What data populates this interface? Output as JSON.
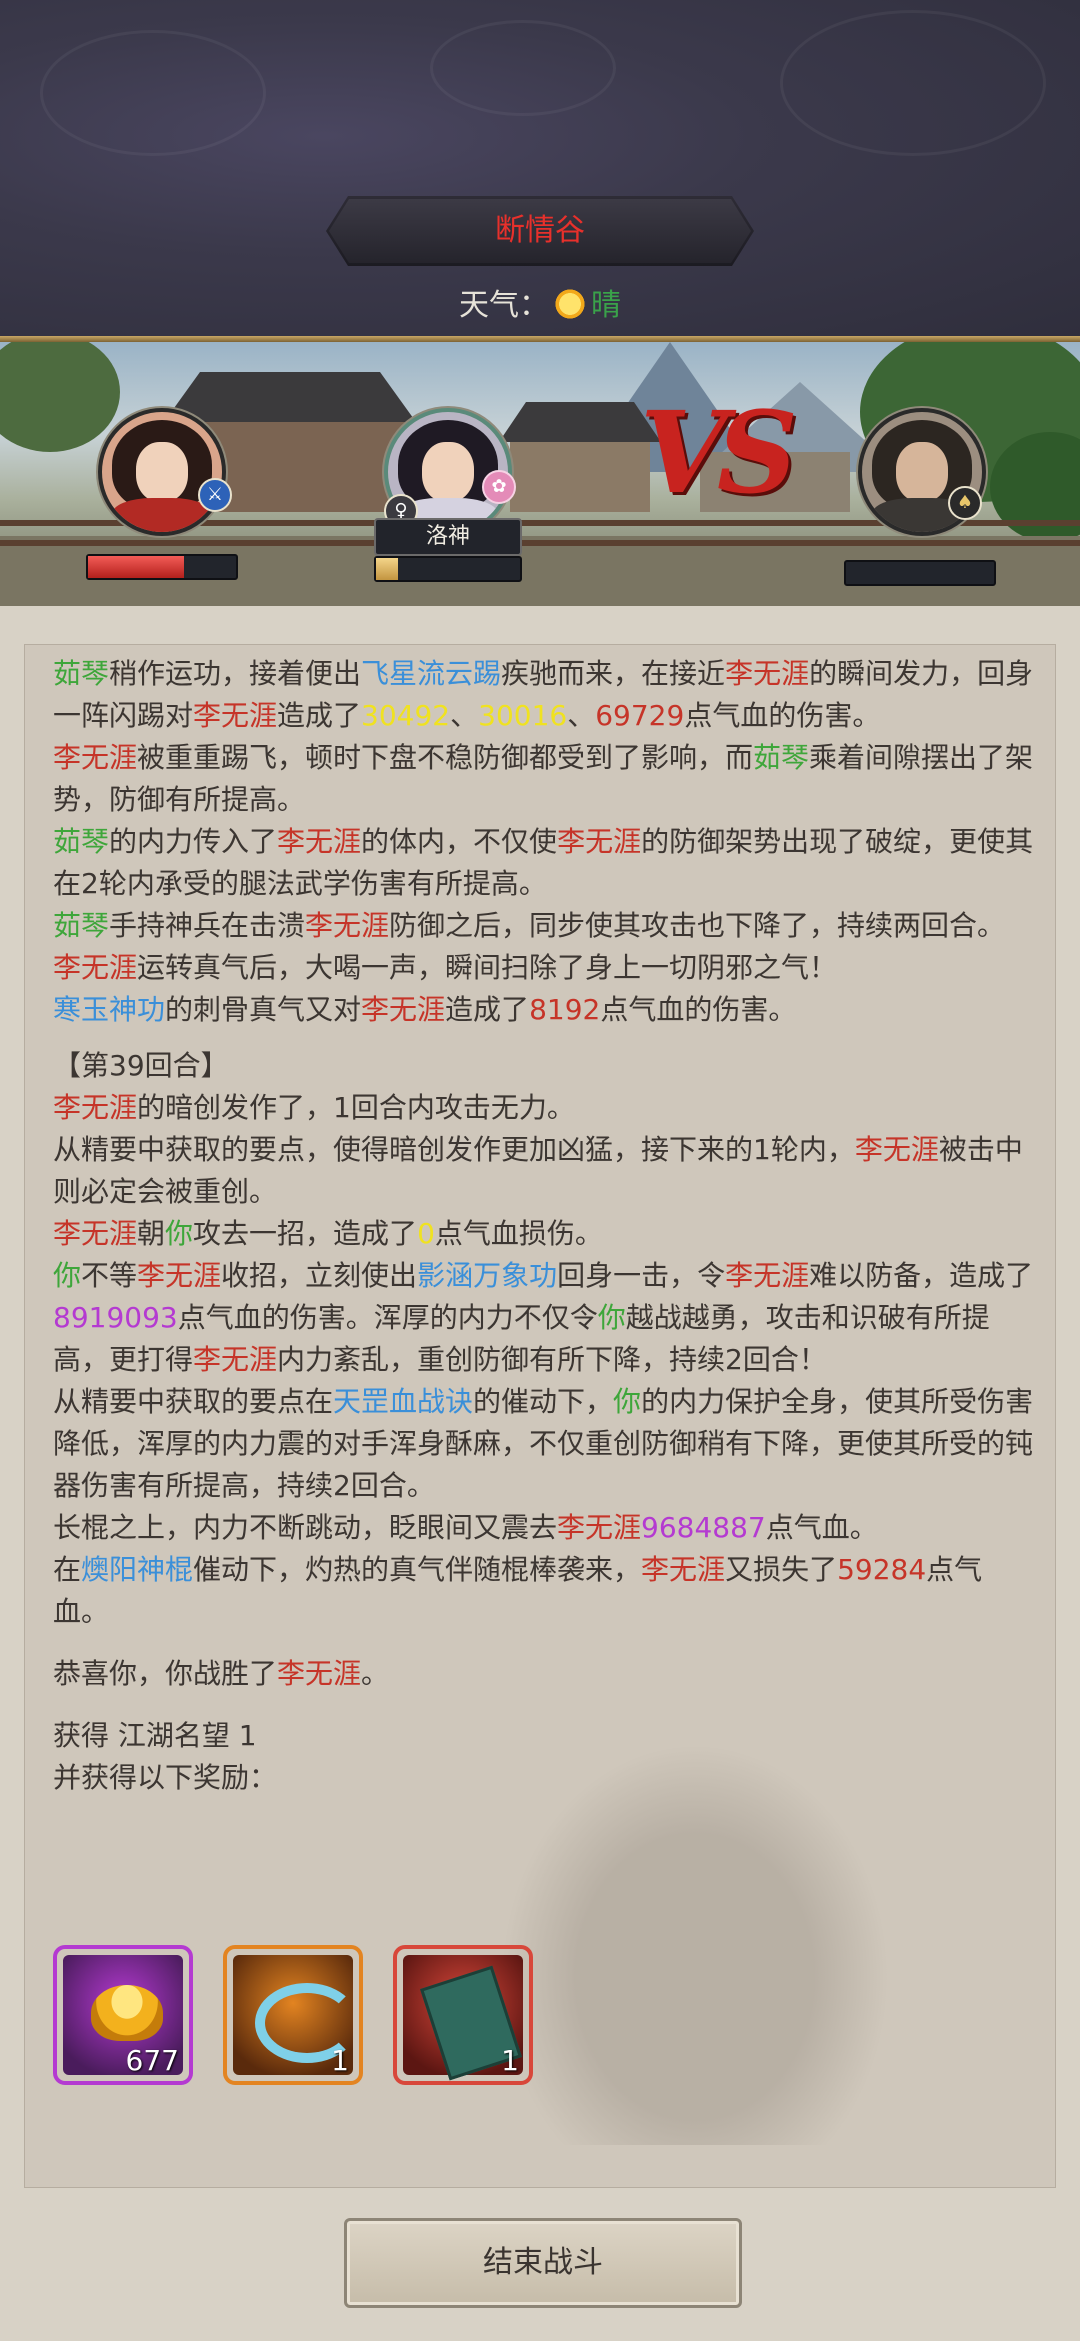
{
  "header": {
    "location": "断情谷",
    "weather_label": "天气：",
    "weather_icon": "sun-icon",
    "weather_condition": "晴"
  },
  "battle": {
    "vs_text": "VS",
    "pet_name": "洛神",
    "left_hp_fraction": 0.65,
    "pet_energy_fraction": 0.15,
    "enemy_hp_fraction": 0.0
  },
  "log": [
    [
      [
        "green",
        "茹琴"
      ],
      [
        "",
        "稍作运功，接着便出"
      ],
      [
        "blue",
        "飞星流云踢"
      ],
      [
        "",
        "疾驰而来，在接近"
      ],
      [
        "red",
        "李无涯"
      ],
      [
        "",
        "的瞬间发力，回身一阵闪踢对"
      ],
      [
        "red",
        "李无涯"
      ],
      [
        "",
        "造成了"
      ],
      [
        "yellow",
        "30492"
      ],
      [
        "",
        "、"
      ],
      [
        "yellow",
        "30016"
      ],
      [
        "",
        "、"
      ],
      [
        "red",
        "69729"
      ],
      [
        "",
        "点气血的伤害。"
      ]
    ],
    [
      [
        "red",
        "李无涯"
      ],
      [
        "",
        "被重重踢飞，顿时下盘不稳防御都受到了影响，而"
      ],
      [
        "green",
        "茹琴"
      ],
      [
        "",
        "乘着间隙摆出了架势，防御有所提高。"
      ]
    ],
    [
      [
        "green",
        "茹琴"
      ],
      [
        "",
        "的内力传入了"
      ],
      [
        "red",
        "李无涯"
      ],
      [
        "",
        "的体内，不仅使"
      ],
      [
        "red",
        "李无涯"
      ],
      [
        "",
        "的防御架势出现了破绽，更使其在2轮内承受的腿法武学伤害有所提高。"
      ]
    ],
    [
      [
        "green",
        "茹琴"
      ],
      [
        "",
        "手持神兵在击溃"
      ],
      [
        "red",
        "李无涯"
      ],
      [
        "",
        "防御之后，同步使其攻击也下降了，持续两回合。"
      ]
    ],
    [
      [
        "red",
        "李无涯"
      ],
      [
        "",
        "运转真气后，大喝一声，瞬间扫除了身上一切阴邪之气！"
      ]
    ],
    [
      [
        "blue",
        "寒玉神功"
      ],
      [
        "",
        "的刺骨真气又对"
      ],
      [
        "red",
        "李无涯"
      ],
      [
        "",
        "造成了"
      ],
      [
        "red",
        "8192"
      ],
      [
        "",
        "点气血的伤害。"
      ]
    ]
  ],
  "round_title": "【第39回合】",
  "round_log": [
    [
      [
        "red",
        "李无涯"
      ],
      [
        "",
        "的暗创发作了，1回合内攻击无力。"
      ]
    ],
    [
      [
        "",
        "从精要中获取的要点，使得暗创发作更加凶猛，接下来的1轮内，"
      ],
      [
        "red",
        "李无涯"
      ],
      [
        "",
        "被击中则必定会被重创。"
      ]
    ],
    [
      [
        "red",
        "李无涯"
      ],
      [
        "",
        "朝"
      ],
      [
        "green",
        "你"
      ],
      [
        "",
        "攻去一招，造成了"
      ],
      [
        "yellow",
        "0"
      ],
      [
        "",
        "点气血损伤。"
      ]
    ],
    [
      [
        "green",
        "你"
      ],
      [
        "",
        "不等"
      ],
      [
        "red",
        "李无涯"
      ],
      [
        "",
        "收招，立刻使出"
      ],
      [
        "blue",
        "影涵万象功"
      ],
      [
        "",
        "回身一击，令"
      ],
      [
        "red",
        "李无涯"
      ],
      [
        "",
        "难以防备，造成了"
      ],
      [
        "purple",
        "8919093"
      ],
      [
        "",
        "点气血的伤害。浑厚的内力不仅令"
      ],
      [
        "green",
        "你"
      ],
      [
        "",
        "越战越勇，攻击和识破有所提高，更打得"
      ],
      [
        "red",
        "李无涯"
      ],
      [
        "",
        "内力紊乱，重创防御有所下降，持续2回合！"
      ]
    ],
    [
      [
        "",
        "从精要中获取的要点在"
      ],
      [
        "blue",
        "天罡血战诀"
      ],
      [
        "",
        "的催动下，"
      ],
      [
        "green",
        "你"
      ],
      [
        "",
        "的内力保护全身，使其所受伤害降低，浑厚的内力震的对手浑身酥麻，不仅重创防御稍有下降，更使其所受的钝器伤害有所提高，持续2回合。"
      ]
    ],
    [
      [
        "",
        "长棍之上，内力不断跳动，眨眼间又震去"
      ],
      [
        "red",
        "李无涯"
      ],
      [
        "purple",
        "9684887"
      ],
      [
        "",
        "点气血。"
      ]
    ],
    [
      [
        "",
        "在"
      ],
      [
        "blue",
        "燠阳神棍"
      ],
      [
        "",
        "催动下，灼热的真气伴随棍棒袭来，"
      ],
      [
        "red",
        "李无涯"
      ],
      [
        "",
        "又损失了"
      ],
      [
        "red",
        "59284"
      ],
      [
        "",
        "点气血。"
      ]
    ]
  ],
  "victory": [
    [
      "",
      "恭喜你，你战胜了"
    ],
    [
      "red",
      "李无涯"
    ],
    [
      "",
      "。"
    ]
  ],
  "gain_line": "获得 江湖名望 1",
  "rewards_label": "并获得以下奖励：",
  "rewards": [
    {
      "icon": "gold-ingot-icon",
      "count": "677",
      "frame": "#b43ad1",
      "bg": "#4a1c5c"
    },
    {
      "icon": "cloud-scroll-icon",
      "count": "1",
      "frame": "#e38421",
      "bg": "#5a2a0c"
    },
    {
      "icon": "book-icon",
      "count": "1",
      "frame": "#d8473a",
      "bg": "#5c1612"
    }
  ],
  "end_button": "结束战斗"
}
